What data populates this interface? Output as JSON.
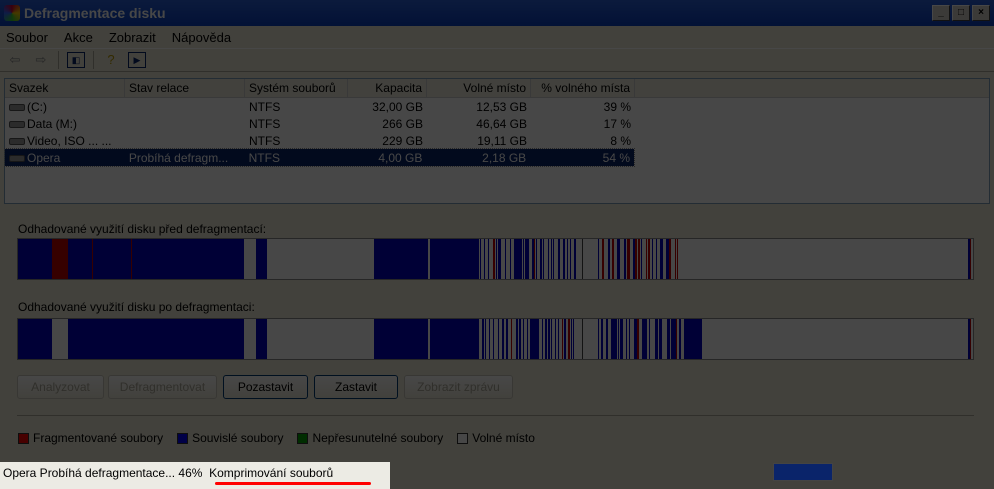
{
  "window": {
    "title": "Defragmentace disku",
    "min": "_",
    "max": "□",
    "close": "×"
  },
  "menu": [
    "Soubor",
    "Akce",
    "Zobrazit",
    "Nápověda"
  ],
  "toolbar": {
    "back": "⇦",
    "forward": "⇨",
    "console": "◧",
    "help": "?",
    "action": "▶"
  },
  "table": {
    "headers": [
      "Svazek",
      "Stav relace",
      "Systém souborů",
      "Kapacita",
      "Volné místo",
      "% volného místa"
    ],
    "rows": [
      [
        "(C:)",
        "",
        "NTFS",
        "32,00 GB",
        "12,53 GB",
        "39 %"
      ],
      [
        "Data (M:)",
        "",
        "NTFS",
        "266 GB",
        "46,64 GB",
        "17 %"
      ],
      [
        "Video, ISO ... ...",
        "",
        "NTFS",
        "229 GB",
        "19,11 GB",
        "8 %"
      ],
      [
        "Opera",
        "Probíhá defragm...",
        "NTFS",
        "4,00 GB",
        "2,18 GB",
        "54 %"
      ]
    ]
  },
  "maps": {
    "before_label": "Odhadované využití disku před defragmentací:",
    "after_label": "Odhadované využití disku po defragmentaci:"
  },
  "buttons": [
    "Analyzovat",
    "Defragmentovat",
    "Pozastavit",
    "Zastavit",
    "Zobrazit zprávu"
  ],
  "legend": [
    {
      "label": "Fragmentované soubory",
      "color": "#ff0000"
    },
    {
      "label": "Souvislé soubory",
      "color": "#0000ff"
    },
    {
      "label": "Nepřesunutelné soubory",
      "color": "#00a000"
    },
    {
      "label": "Volné místo",
      "color": "#ffffff"
    }
  ],
  "status": {
    "text": "Opera Probíhá defragmentace... 46%",
    "phase": "Komprimování souborů",
    "progress_percent": 46
  }
}
